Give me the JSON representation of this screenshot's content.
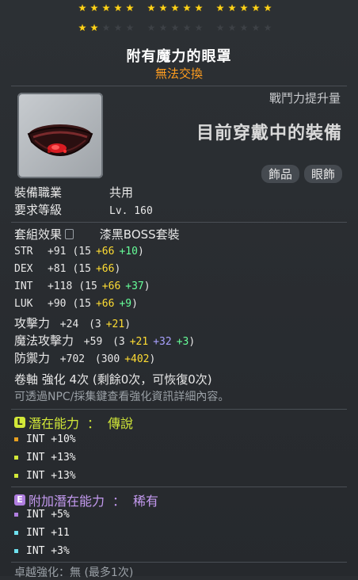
{
  "stars": {
    "row1": [
      5,
      5,
      5
    ],
    "row2_filled": 2,
    "total_per_group": 5
  },
  "item": {
    "name": "附有魔力的眼罩",
    "trade": "無法交換",
    "power_label": "戰鬥力提升量",
    "equipped_label": "目前穿戴中的裝備",
    "tags": [
      "飾品",
      "眼飾"
    ]
  },
  "requirements": {
    "job_label": "裝備職業",
    "job_value": "共用",
    "level_label": "要求等級",
    "level_value": "Lv. 160"
  },
  "set": {
    "label": "套組效果",
    "value": "漆黑BOSS套裝"
  },
  "stats": [
    {
      "name": "STR",
      "total": "+91",
      "base": "(15",
      "add1": "+66",
      "add2": "+10",
      "add2_color": "g",
      "close": ")"
    },
    {
      "name": "DEX",
      "total": "+81",
      "base": "(15",
      "add1": "+66",
      "add2": "",
      "add2_color": "g",
      "close": ")"
    },
    {
      "name": "INT",
      "total": "+118",
      "base": "(15",
      "add1": "+66",
      "add2": "+37",
      "add2_color": "g",
      "close": ")"
    },
    {
      "name": "LUK",
      "total": "+90",
      "base": "(15",
      "add1": "+66",
      "add2": "+9",
      "add2_color": "g",
      "close": ")"
    }
  ],
  "attack": {
    "label": "攻擊力",
    "total": "+24",
    "base": "(3",
    "add1": "+21",
    "close": ")"
  },
  "magic": {
    "label": "魔法攻擊力",
    "total": "+59",
    "base": "(3",
    "add1": "+21",
    "add2": "+32",
    "add3": "+3",
    "close": ")"
  },
  "defense": {
    "label": "防禦力",
    "total": "+702",
    "base": "(300",
    "add1": "+402",
    "close": ")"
  },
  "scroll": {
    "text": "卷軸 強化 4次 (剩餘0次，可恢復0次)",
    "hint": "可透過NPC/採集鍵查看強化資訊詳細內容。"
  },
  "potential": {
    "label": "潛在能力",
    "sep": "：",
    "grade": "傳說",
    "lines": [
      "INT +10%",
      "INT +13%",
      "INT +13%"
    ],
    "dot_colors": [
      "#e8a020",
      "#d2e838",
      "#d2e838"
    ]
  },
  "bonus_potential": {
    "label": "附加潛在能力",
    "sep": "：",
    "grade": "稀有",
    "lines": [
      "INT +5%",
      "INT +11",
      "INT +3%"
    ],
    "dot_colors": [
      "#b07ee0",
      "#6ee0ee",
      "#6ee0ee"
    ]
  },
  "bottom": {
    "text": "卓越強化：無 (最多1次)"
  },
  "colors": {
    "star_on": "#ffd31a",
    "untradeable": "#ff9d1f",
    "bonus_yellow": "#ffdd33",
    "bonus_green": "#66ff99",
    "bonus_purple": "#a9a2ff",
    "legendary": "#d2e838",
    "rare": "#b07ee0"
  }
}
